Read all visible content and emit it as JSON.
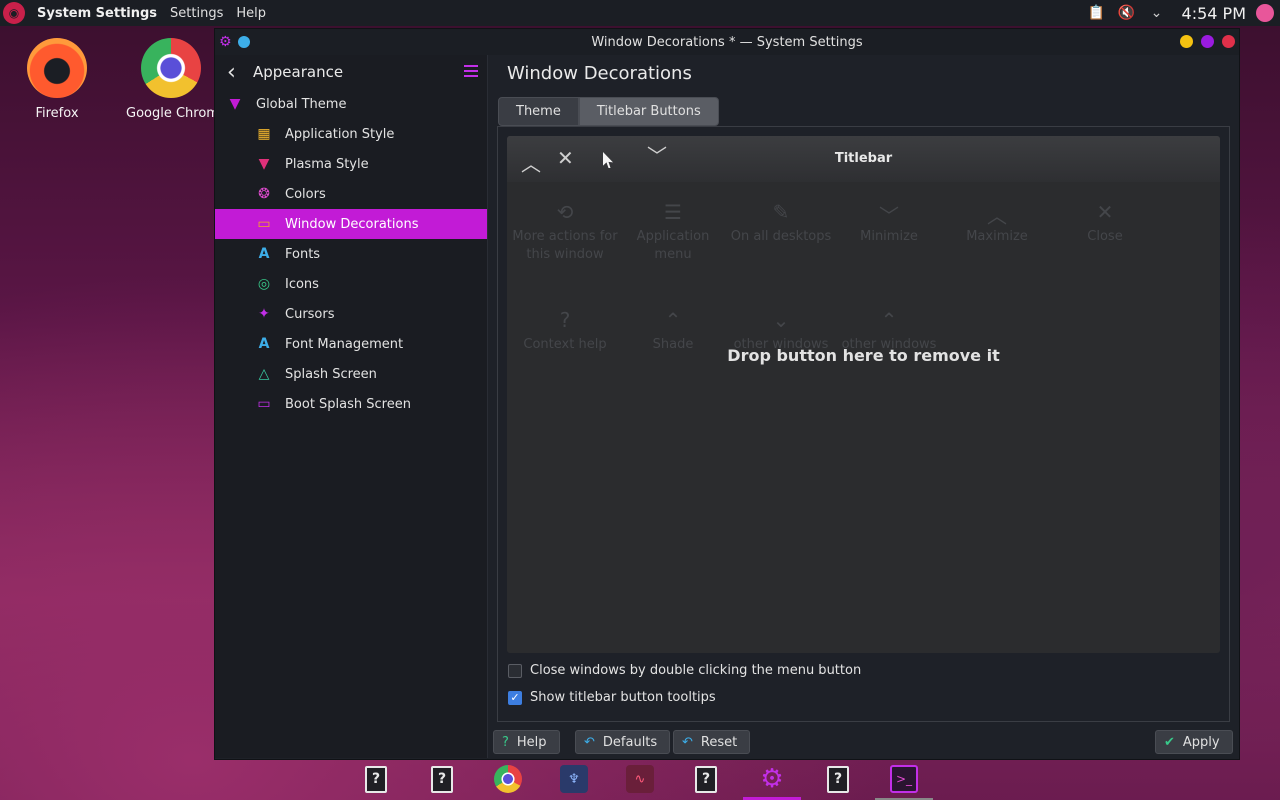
{
  "top_panel": {
    "app_name": "System Settings",
    "menus": [
      "Settings",
      "Help"
    ],
    "clock": "4:54 PM",
    "tray_icons": [
      "clipboard-icon",
      "volume-muted-icon",
      "chevron-down-icon"
    ]
  },
  "desktop": {
    "icons": [
      {
        "label": "Firefox",
        "icon": "firefox-icon"
      },
      {
        "label": "Google Chrom",
        "icon": "chrome-icon"
      }
    ]
  },
  "window": {
    "title": "Window Decorations * — System Settings",
    "controls": {
      "minimize": "#f5c211",
      "maximize": "#9a1be0",
      "close": "#e0304a"
    },
    "sidebar": {
      "header": "Appearance",
      "items": [
        {
          "label": "Global Theme",
          "icon": "global-theme-icon",
          "color": "#c21bd6"
        },
        {
          "label": "Application Style",
          "icon": "application-style-icon",
          "color": "#f5b82e"
        },
        {
          "label": "Plasma Style",
          "icon": "plasma-style-icon",
          "color": "#e0307a"
        },
        {
          "label": "Colors",
          "icon": "colors-icon",
          "color": "#e04bd0"
        },
        {
          "label": "Window Decorations",
          "icon": "window-decorations-icon",
          "color": "#f5a623"
        },
        {
          "label": "Fonts",
          "icon": "fonts-icon",
          "color": "#3daee9"
        },
        {
          "label": "Icons",
          "icon": "icons-icon",
          "color": "#38c98a"
        },
        {
          "label": "Cursors",
          "icon": "cursors-icon",
          "color": "#c22fe8"
        },
        {
          "label": "Font Management",
          "icon": "font-management-icon",
          "color": "#3daee9"
        },
        {
          "label": "Splash Screen",
          "icon": "splash-screen-icon",
          "color": "#38c9a0"
        },
        {
          "label": "Boot Splash Screen",
          "icon": "boot-splash-screen-icon",
          "color": "#c22fe8"
        }
      ],
      "active_index": 4
    },
    "content": {
      "page_title": "Window Decorations",
      "tabs": [
        {
          "label": "Theme",
          "active": false
        },
        {
          "label": "Titlebar Buttons",
          "active": true
        }
      ],
      "titlebar_preview": {
        "title": "Titlebar",
        "buttons": [
          "maximize-icon",
          "close-icon",
          "minimize-icon"
        ]
      },
      "available_buttons": [
        {
          "label": "More actions for this window",
          "icon": "more-actions-icon"
        },
        {
          "label": "Application menu",
          "icon": "application-menu-icon"
        },
        {
          "label": "On all desktops",
          "icon": "pin-icon"
        },
        {
          "label": "Minimize",
          "icon": "minimize-icon"
        },
        {
          "label": "Maximize",
          "icon": "maximize-icon"
        },
        {
          "label": "Close",
          "icon": "close-icon"
        },
        {
          "label": "Context help",
          "icon": "help-icon"
        },
        {
          "label": "Shade",
          "icon": "shade-icon"
        },
        {
          "label": "other windows",
          "icon": "keep-below-icon"
        },
        {
          "label": "other windows",
          "icon": "keep-above-icon"
        }
      ],
      "drop_message": "Drop button here to remove it",
      "options": [
        {
          "label": "Close windows by double clicking the menu button",
          "checked": false
        },
        {
          "label": "Show titlebar button tooltips",
          "checked": true
        }
      ]
    },
    "buttons": {
      "help": "Help",
      "defaults": "Defaults",
      "reset": "Reset",
      "apply": "Apply"
    }
  },
  "taskbar": {
    "items": [
      {
        "icon": "unknown-app-icon"
      },
      {
        "icon": "unknown-app-icon"
      },
      {
        "icon": "chrome-icon"
      },
      {
        "icon": "tree-app-icon"
      },
      {
        "icon": "system-monitor-icon"
      },
      {
        "icon": "unknown-app-icon"
      },
      {
        "icon": "system-settings-icon",
        "active": true
      },
      {
        "icon": "unknown-app-icon"
      },
      {
        "icon": "terminal-icon",
        "open": true
      }
    ]
  }
}
